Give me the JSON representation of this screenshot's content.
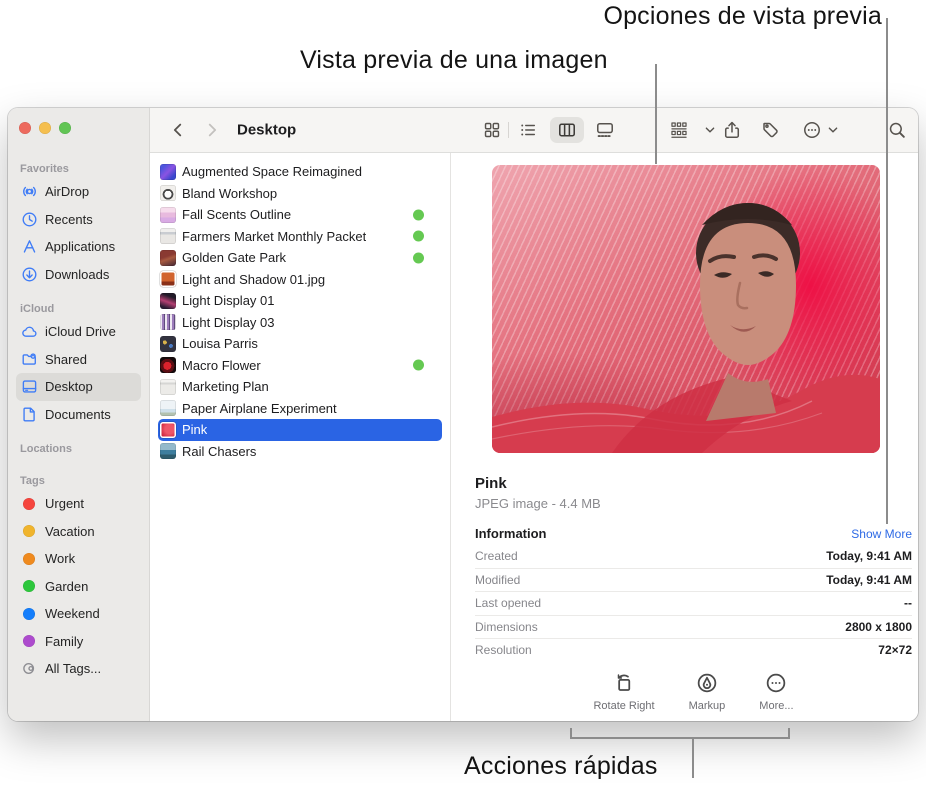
{
  "callouts": {
    "preview_options": "Opciones de vista previa",
    "image_preview": "Vista previa de una imagen",
    "quick_actions": "Acciones rápidas"
  },
  "colors": {
    "accent_selection": "#2a64e4",
    "sidebar_icon_blue": "#3f7cf6",
    "badge_green": "#65c952",
    "link_blue": "#2e6ae5",
    "callout_line_gray": "#8c8c8c",
    "traffic_red": "#ed6a5e",
    "traffic_yellow": "#f5bf4f",
    "traffic_green": "#61c554"
  },
  "window": {
    "controls": [
      "close",
      "minimize",
      "zoom"
    ],
    "toolbar": {
      "title": "Desktop",
      "icons": [
        "back",
        "forward",
        "icon-view",
        "list-view",
        "column-view",
        "gallery-view",
        "group",
        "share",
        "tag",
        "more",
        "search"
      ],
      "selected_view": "column-view"
    },
    "sidebar": {
      "sections": [
        {
          "title": "Favorites",
          "items": [
            {
              "icon": "airdrop",
              "label": "AirDrop"
            },
            {
              "icon": "recents",
              "label": "Recents"
            },
            {
              "icon": "applications",
              "label": "Applications"
            },
            {
              "icon": "downloads",
              "label": "Downloads"
            }
          ]
        },
        {
          "title": "iCloud",
          "items": [
            {
              "icon": "icloud",
              "label": "iCloud Drive"
            },
            {
              "icon": "shared",
              "label": "Shared"
            },
            {
              "icon": "desktop",
              "label": "Desktop",
              "selected": true
            },
            {
              "icon": "documents",
              "label": "Documents"
            }
          ]
        },
        {
          "title": "Locations",
          "items": []
        },
        {
          "title": "Tags",
          "items": [
            {
              "icon": "tag-dot",
              "color": "#f5453d",
              "label": "Urgent"
            },
            {
              "icon": "tag-dot",
              "color": "#f0b42c",
              "label": "Vacation"
            },
            {
              "icon": "tag-dot",
              "color": "#ef8a1e",
              "label": "Work"
            },
            {
              "icon": "tag-dot",
              "color": "#2dc73c",
              "label": "Garden"
            },
            {
              "icon": "tag-dot",
              "color": "#147efb",
              "label": "Weekend"
            },
            {
              "icon": "tag-dot",
              "color": "#ad4bcd",
              "label": "Family"
            },
            {
              "icon": "all-tags",
              "label": "All Tags..."
            }
          ]
        }
      ]
    },
    "file_list": [
      {
        "label": "Augmented Space Reimagined",
        "icon": "augmented",
        "badge": false
      },
      {
        "label": "Bland Workshop",
        "icon": "bland",
        "badge": false
      },
      {
        "label": "Fall Scents Outline",
        "icon": "fall",
        "badge": true
      },
      {
        "label": "Farmers Market Monthly Packet",
        "icon": "farmers",
        "badge": true
      },
      {
        "label": "Golden Gate Park",
        "icon": "golden",
        "badge": true
      },
      {
        "label": "Light and Shadow 01.jpg",
        "icon": "lshadow",
        "badge": false
      },
      {
        "label": "Light Display 01",
        "icon": "ld01",
        "badge": false
      },
      {
        "label": "Light Display 03",
        "icon": "ld03",
        "badge": false
      },
      {
        "label": "Louisa Parris",
        "icon": "louisa",
        "badge": false
      },
      {
        "label": "Macro Flower",
        "icon": "macro",
        "badge": true
      },
      {
        "label": "Marketing Plan",
        "icon": "marketing",
        "badge": false
      },
      {
        "label": "Paper Airplane Experiment",
        "icon": "paper",
        "badge": false
      },
      {
        "label": "Pink",
        "icon": "pink",
        "badge": false,
        "selected": true
      },
      {
        "label": "Rail Chasers",
        "icon": "rail",
        "badge": false
      }
    ],
    "preview": {
      "file_title": "Pink",
      "file_meta": "JPEG image - 4.4 MB",
      "info_header": "Information",
      "show_more_label": "Show More",
      "info_rows": [
        {
          "label": "Created",
          "value": "Today, 9:41 AM"
        },
        {
          "label": "Modified",
          "value": "Today, 9:41 AM"
        },
        {
          "label": "Last opened",
          "value": "--"
        },
        {
          "label": "Dimensions",
          "value": "2800 x 1800"
        },
        {
          "label": "Resolution",
          "value": "72×72"
        }
      ],
      "quick_actions": [
        {
          "icon": "rotate",
          "label": "Rotate Right"
        },
        {
          "icon": "markup",
          "label": "Markup"
        },
        {
          "icon": "more",
          "label": "More..."
        }
      ]
    }
  }
}
